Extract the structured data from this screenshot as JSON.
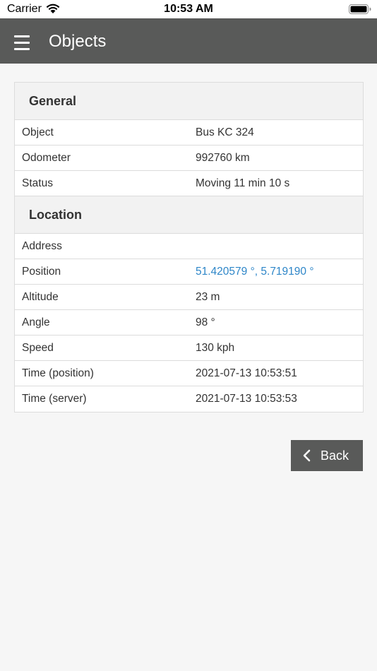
{
  "status_bar": {
    "carrier": "Carrier",
    "time": "10:53 AM",
    "icons": [
      "wifi-icon",
      "battery-icon"
    ]
  },
  "header": {
    "title": "Objects",
    "menu_icon": "hamburger-menu-icon",
    "background": "#595a59"
  },
  "general": {
    "title": "General",
    "rows": [
      {
        "label": "Object",
        "value": "Bus KC 324"
      },
      {
        "label": "Odometer",
        "value": "992760 km"
      },
      {
        "label": "Status",
        "value": "Moving 11 min 10 s"
      }
    ]
  },
  "location": {
    "title": "Location",
    "rows": [
      {
        "label": "Address",
        "value": ""
      },
      {
        "label": "Position",
        "value": "51.420579 °, 5.719190 °"
      },
      {
        "label": "Altitude",
        "value": "23 m"
      },
      {
        "label": "Angle",
        "value": "98 °"
      },
      {
        "label": "Speed",
        "value": "130 kph"
      },
      {
        "label": "Time (position)",
        "value": "2021-07-13 10:53:51"
      },
      {
        "label": "Time (server)",
        "value": "2021-07-13 10:53:53"
      }
    ]
  },
  "actions": {
    "back_label": "Back",
    "back_icon": "chevron-left-icon"
  },
  "colors": {
    "link": "#2e86c8",
    "button": "#595a59"
  }
}
